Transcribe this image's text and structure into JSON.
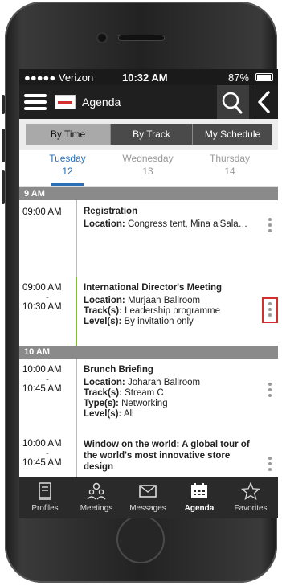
{
  "status_bar": {
    "carrier": "●●●●● Verizon",
    "time": "10:32 AM",
    "right": "87%"
  },
  "app_bar": {
    "title": "Agenda",
    "search_icon": "search-icon",
    "back_icon": "back-arrow-icon"
  },
  "segments": [
    {
      "label": "By Time",
      "active": true
    },
    {
      "label": "By Track",
      "active": false
    },
    {
      "label": "My Schedule",
      "active": false
    }
  ],
  "days": [
    {
      "name": "Tuesday",
      "num": "12",
      "active": true
    },
    {
      "name": "Wednesday",
      "num": "13",
      "active": false
    },
    {
      "name": "Thursday",
      "num": "14",
      "active": false
    }
  ],
  "hours": [
    "9 AM",
    "10 AM"
  ],
  "sessions": [
    {
      "start": "09:00 AM",
      "end": "",
      "title": "Registration",
      "lines": [
        {
          "k": "Location:",
          "v": "Congress tent, Mina a'Salam ent..."
        }
      ]
    },
    {
      "start": "09:00 AM",
      "dash": "-",
      "end": "10:30 AM",
      "title": "International Director's Meeting",
      "lines": [
        {
          "k": "Location:",
          "v": "Murjaan Ballroom"
        },
        {
          "k": "Track(s):",
          "v": "Leadership programme"
        },
        {
          "k": "Level(s):",
          "v": "By invitation only"
        }
      ]
    },
    {
      "start": "10:00 AM",
      "dash": "-",
      "end": "10:45 AM",
      "title": "Brunch Briefing",
      "lines": [
        {
          "k": "Location:",
          "v": "Joharah Ballroom"
        },
        {
          "k": "Track(s):",
          "v": "Stream C"
        },
        {
          "k": "Type(s):",
          "v": "Networking"
        },
        {
          "k": "Level(s):",
          "v": "All"
        }
      ]
    },
    {
      "start": "10:00 AM",
      "dash": "-",
      "end": "10:45 AM",
      "title": "Window on the world: A global tour of the world's most innovative store design"
    }
  ],
  "tabs": [
    {
      "label": "Profiles",
      "icon": "profile-card-icon",
      "active": false
    },
    {
      "label": "Meetings",
      "icon": "meetings-icon",
      "active": false
    },
    {
      "label": "Messages",
      "icon": "envelope-icon",
      "active": false
    },
    {
      "label": "Agenda",
      "icon": "calendar-icon",
      "active": true
    },
    {
      "label": "Favorites",
      "icon": "star-icon",
      "active": false
    }
  ],
  "colors": {
    "accent": "#2a6fb5",
    "highlight": "#d0312d",
    "track_leadership": "#7fbf2f"
  }
}
